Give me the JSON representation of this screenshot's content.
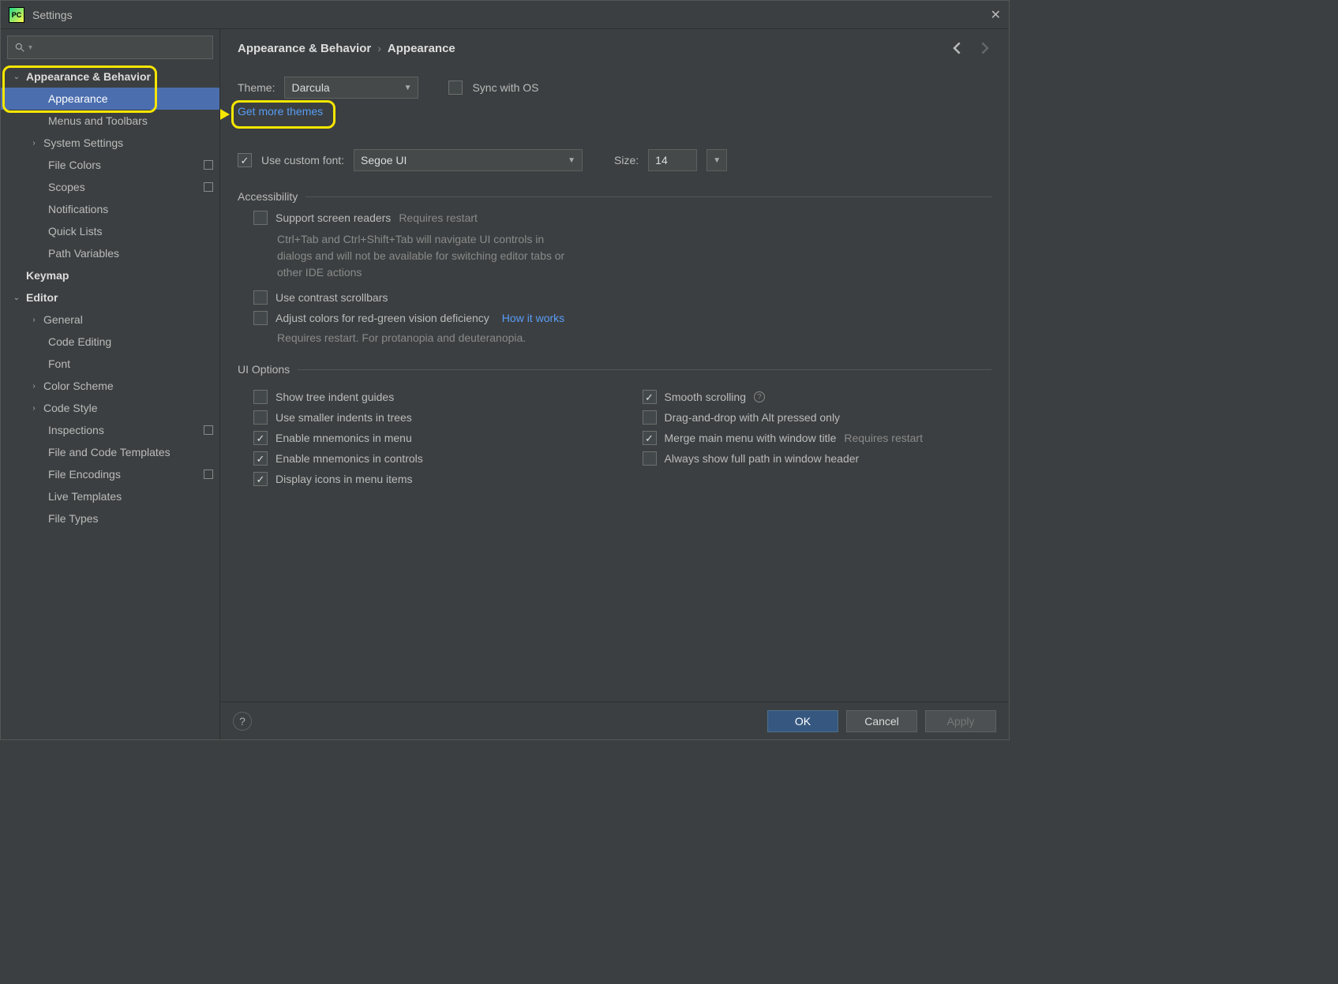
{
  "window": {
    "title": "Settings"
  },
  "breadcrumb": {
    "a": "Appearance & Behavior",
    "b": "Appearance"
  },
  "sidebar": {
    "search_placeholder": "",
    "items": [
      {
        "label": "Appearance & Behavior",
        "bold": true,
        "chev": "down",
        "indent": 0
      },
      {
        "label": "Appearance",
        "indent": 2,
        "selected": true
      },
      {
        "label": "Menus and Toolbars",
        "indent": 2
      },
      {
        "label": "System Settings",
        "indent": 1,
        "chev": "right"
      },
      {
        "label": "File Colors",
        "indent": 2,
        "badge": true
      },
      {
        "label": "Scopes",
        "indent": 2,
        "badge": true
      },
      {
        "label": "Notifications",
        "indent": 2
      },
      {
        "label": "Quick Lists",
        "indent": 2
      },
      {
        "label": "Path Variables",
        "indent": 2
      },
      {
        "label": "Keymap",
        "bold": true,
        "indent": 0
      },
      {
        "label": "Editor",
        "bold": true,
        "chev": "down",
        "indent": 0
      },
      {
        "label": "General",
        "indent": 1,
        "chev": "right"
      },
      {
        "label": "Code Editing",
        "indent": 2
      },
      {
        "label": "Font",
        "indent": 2
      },
      {
        "label": "Color Scheme",
        "indent": 1,
        "chev": "right"
      },
      {
        "label": "Code Style",
        "indent": 1,
        "chev": "right"
      },
      {
        "label": "Inspections",
        "indent": 2,
        "badge": true
      },
      {
        "label": "File and Code Templates",
        "indent": 2
      },
      {
        "label": "File Encodings",
        "indent": 2,
        "badge": true
      },
      {
        "label": "Live Templates",
        "indent": 2
      },
      {
        "label": "File Types",
        "indent": 2
      }
    ]
  },
  "theme": {
    "label": "Theme:",
    "value": "Darcula",
    "sync": "Sync with OS",
    "more": "Get more themes"
  },
  "font": {
    "use_label": "Use custom font:",
    "value": "Segoe UI",
    "size_label": "Size:",
    "size_value": "14"
  },
  "accessibility": {
    "title": "Accessibility",
    "screen_readers": "Support screen readers",
    "requires_restart": "Requires restart",
    "note": "Ctrl+Tab and Ctrl+Shift+Tab will navigate UI controls in dialogs and will not be available for switching editor tabs or other IDE actions",
    "contrast": "Use contrast scrollbars",
    "colorblind": "Adjust colors for red-green vision deficiency",
    "how": "How it works",
    "colorblind_note": "Requires restart. For protanopia and deuteranopia."
  },
  "ui": {
    "title": "UI Options",
    "left": [
      {
        "label": "Show tree indent guides",
        "checked": false
      },
      {
        "label": "Use smaller indents in trees",
        "checked": false
      },
      {
        "label": "Enable mnemonics in menu",
        "checked": true
      },
      {
        "label": "Enable mnemonics in controls",
        "checked": true
      },
      {
        "label": "Display icons in menu items",
        "checked": true
      }
    ],
    "right": [
      {
        "label": "Smooth scrolling",
        "checked": true,
        "help": true
      },
      {
        "label": "Drag-and-drop with Alt pressed only",
        "checked": false
      },
      {
        "label": "Merge main menu with window title",
        "checked": true,
        "hint": "Requires restart"
      },
      {
        "label": "Always show full path in window header",
        "checked": false
      }
    ]
  },
  "buttons": {
    "ok": "OK",
    "cancel": "Cancel",
    "apply": "Apply"
  }
}
